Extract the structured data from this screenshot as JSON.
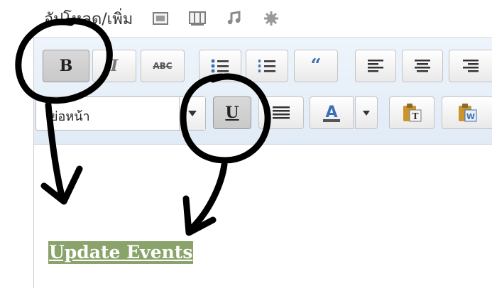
{
  "upload": {
    "label": "อัปโหลด/เพิ่ม",
    "icons": [
      "image-icon",
      "video-icon",
      "audio-icon",
      "media-icon"
    ]
  },
  "toolbar": {
    "row1": [
      "bold",
      "italic",
      "strikethrough",
      "bulleted-list",
      "numbered-list",
      "blockquote",
      "align-left",
      "align-center",
      "align-right"
    ],
    "row2": [
      "format-select",
      "underline",
      "justify",
      "text-color",
      "text-color-dropdown",
      "paste-as-text",
      "paste-from-word"
    ],
    "bold_glyph": "B",
    "italic_glyph": "I",
    "strike_glyph": "ABC",
    "underline_glyph": "U",
    "quote_glyph": "66",
    "text_color_glyph": "A",
    "paste_text_glyph": "T",
    "paste_word_glyph": "W",
    "format_value": "ย่อหน้า"
  },
  "editor": {
    "content_text": "Update Events",
    "highlight_color": "#8aa36a"
  },
  "annotation_color": "#000000"
}
